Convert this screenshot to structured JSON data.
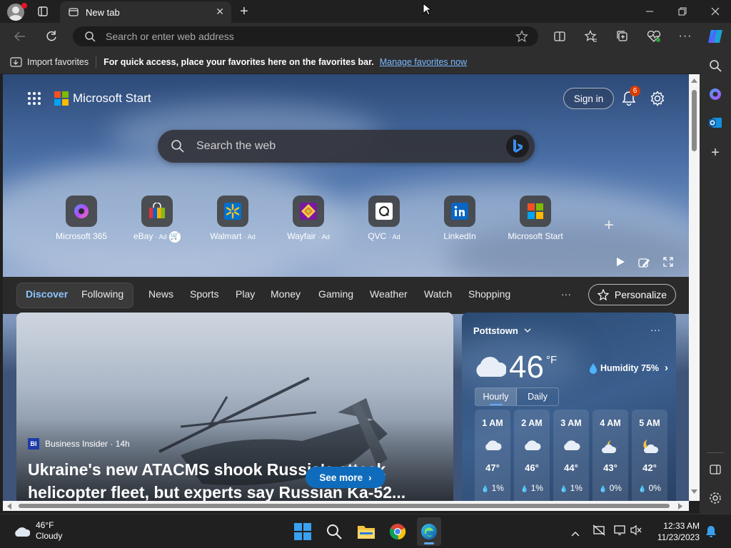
{
  "browser": {
    "tab_title": "New tab",
    "address_placeholder": "Search or enter web address",
    "favbar": {
      "import_label": "Import favorites",
      "hint": "For quick access, place your favorites here on the favorites bar.",
      "manage_link": "Manage favorites now"
    }
  },
  "page": {
    "brand": "Microsoft Start",
    "sign_in": "Sign in",
    "notification_count": "6",
    "search_placeholder": "Search the web",
    "quick_links": [
      {
        "label": "Microsoft 365",
        "ad": ""
      },
      {
        "label": "eBay",
        "ad": "· Ad"
      },
      {
        "label": "Walmart",
        "ad": "· Ad"
      },
      {
        "label": "Wayfair",
        "ad": "· Ad"
      },
      {
        "label": "QVC",
        "ad": "· Ad"
      },
      {
        "label": "LinkedIn",
        "ad": ""
      },
      {
        "label": "Microsoft Start",
        "ad": ""
      }
    ],
    "nav": {
      "discover": "Discover",
      "following": "Following",
      "items": [
        "News",
        "Sports",
        "Play",
        "Money",
        "Gaming",
        "Weather",
        "Watch",
        "Shopping"
      ],
      "more": "···",
      "personalize": "Personalize"
    },
    "hero": {
      "source_badge": "BI",
      "source": "Business Insider · 14h",
      "headline_line1": "Ukraine's new ATACMS shook Russia's attack",
      "headline_line2": "helicopter fleet, but experts say Russian Ka-52...",
      "see_more": "See more"
    },
    "weather": {
      "location": "Pottstown",
      "temp": "46",
      "unit": "°F",
      "humidity": "Humidity 75%",
      "tab_hourly": "Hourly",
      "tab_daily": "Daily",
      "hours": [
        {
          "time": "1 AM",
          "temp": "47°",
          "precip": "1%",
          "icon": "cloud-icon"
        },
        {
          "time": "2 AM",
          "temp": "46°",
          "precip": "1%",
          "icon": "cloud-icon"
        },
        {
          "time": "3 AM",
          "temp": "44°",
          "precip": "1%",
          "icon": "cloud-icon"
        },
        {
          "time": "4 AM",
          "temp": "43°",
          "precip": "0%",
          "icon": "partly-cloudy-night-icon"
        },
        {
          "time": "5 AM",
          "temp": "42°",
          "precip": "0%",
          "icon": "partly-cloudy-night-icon"
        }
      ]
    }
  },
  "taskbar": {
    "weather_temp": "46°F",
    "weather_desc": "Cloudy",
    "time": "12:33 AM",
    "date": "11/23/2023"
  },
  "colors": {
    "accent": "#5fa8ff",
    "link": "#7ab9ff",
    "badge": "#d83b01"
  }
}
